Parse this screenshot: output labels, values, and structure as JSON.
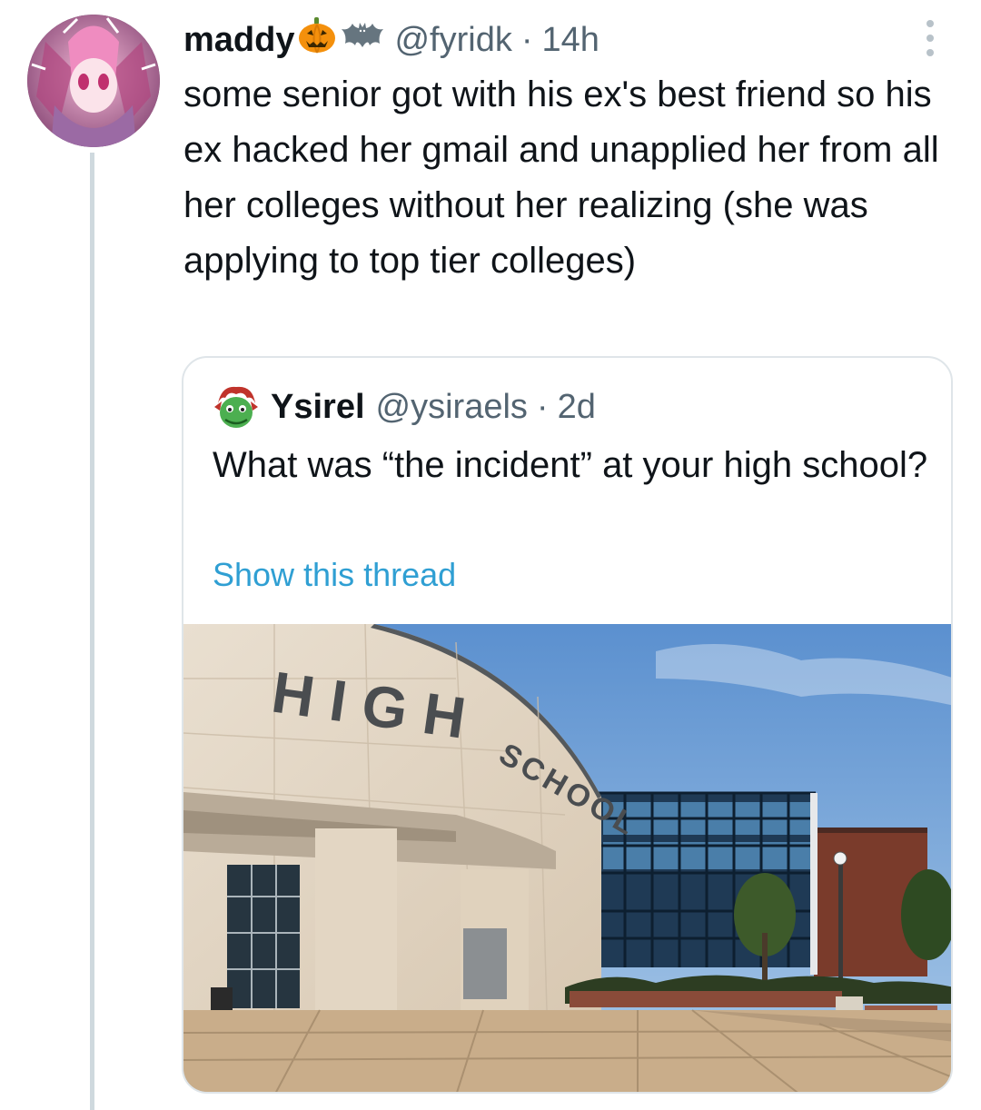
{
  "tweet": {
    "display_name": "maddy",
    "name_emojis": [
      "pumpkin-icon",
      "bat-icon"
    ],
    "handle": "@fyridk",
    "separator": "·",
    "time": "14h",
    "text": "some senior got with his ex's best friend so his ex hacked her gmail and unapplied her from all her colleges without her realizing (she was applying to top tier colleges)"
  },
  "quoted_tweet": {
    "display_name": "Ysirel",
    "handle": "@ysiraels",
    "separator": "·",
    "time": "2d",
    "text": "What was “the incident” at your high school?",
    "show_thread_label": "Show this thread",
    "image": {
      "sign_line1": "HIGH",
      "sign_line2": "SCHOOL"
    }
  },
  "colors": {
    "secondary_text": "#536471",
    "link": "#2f9fd3",
    "border": "#dfe5e9",
    "thread_line": "#cfd9de"
  }
}
